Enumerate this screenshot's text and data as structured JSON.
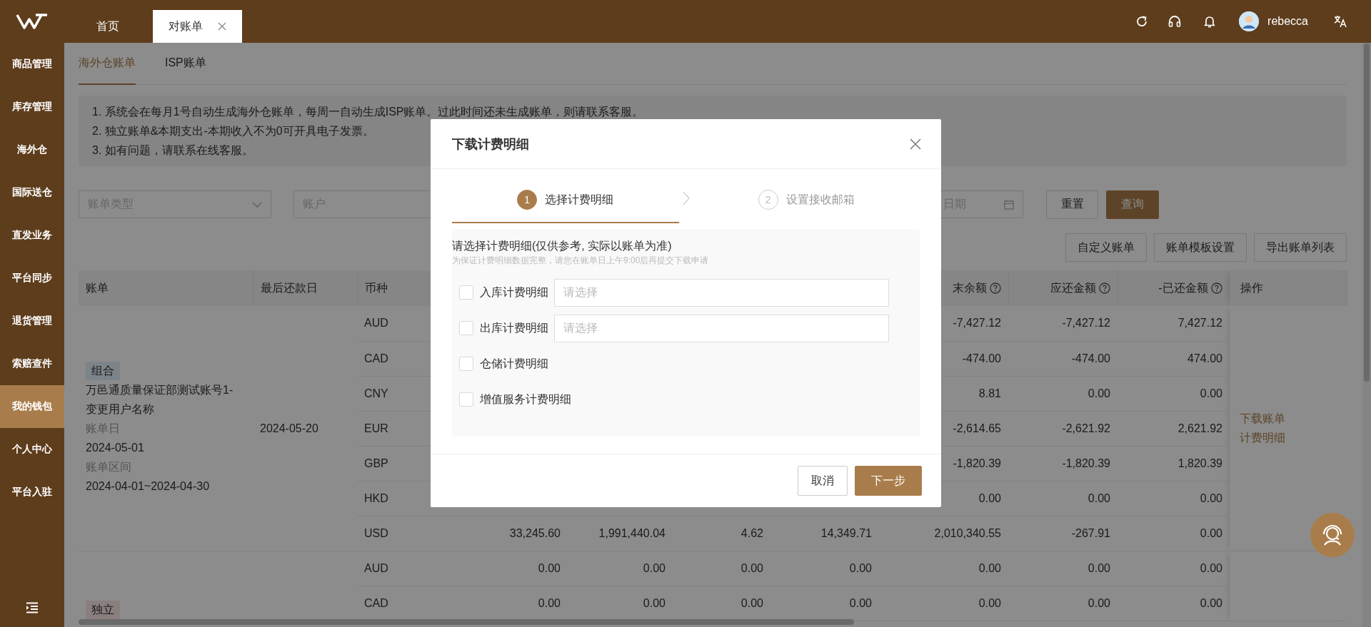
{
  "header": {
    "tabs": [
      {
        "label": "首页",
        "selected": false,
        "closable": false
      },
      {
        "label": "对账单",
        "selected": true,
        "closable": true
      }
    ],
    "user": {
      "name": "rebecca"
    }
  },
  "sidebar": {
    "items": [
      {
        "label": "商品管理",
        "selected": false
      },
      {
        "label": "库存管理",
        "selected": false
      },
      {
        "label": "海外仓",
        "selected": false
      },
      {
        "label": "国际送仓",
        "selected": false
      },
      {
        "label": "直发业务",
        "selected": false
      },
      {
        "label": "平台同步",
        "selected": false
      },
      {
        "label": "退货管理",
        "selected": false
      },
      {
        "label": "索赔查件",
        "selected": false
      },
      {
        "label": "我的钱包",
        "selected": true
      },
      {
        "label": "个人中心",
        "selected": false
      },
      {
        "label": "平台入驻",
        "selected": false
      }
    ]
  },
  "subtabs": [
    {
      "label": "海外仓账单",
      "selected": true
    },
    {
      "label": "ISP账单",
      "selected": false
    }
  ],
  "notice": [
    "1. 系统会在每月1号自动生成海外仓账单，每周一自动生成ISP账单。过此时间还未生成账单，则请联系客服。",
    "2. 独立账单&本期支出-本期收入不为0可开具电子发票。",
    "3. 如有问题，请联系在线客服。"
  ],
  "filters": {
    "bill_type": {
      "placeholder": "账单类型"
    },
    "account": {
      "placeholder": "账户"
    },
    "date": {
      "placeholder": "日期"
    },
    "reset": "重置",
    "search": "查询"
  },
  "actions": [
    "自定义账单",
    "账单模板设置",
    "导出账单列表"
  ],
  "table": {
    "columns": [
      {
        "label": "账单"
      },
      {
        "label": "最后还款日"
      },
      {
        "label": "币种"
      },
      {},
      {},
      {},
      {},
      {
        "label": "末余额",
        "help": true
      },
      {
        "label": "应还金额",
        "help": true
      },
      {
        "label": "-已还金额",
        "help": true
      },
      {
        "label": "操作"
      }
    ],
    "groups": [
      {
        "tag": {
          "text": "组合",
          "kind": "combined"
        },
        "name": "万邑通质量保证部测试账号1-变更用户名称",
        "bill_date_label": "账单日",
        "bill_date": "2024-05-01",
        "period_label": "账单区间",
        "period": "2024-04-01~2024-04-30",
        "due_date": "2024-05-20",
        "actions": [
          "下载账单",
          "计费明细"
        ],
        "lines": [
          {
            "currency": "AUD",
            "column_8": "-7,427.12",
            "payable": "-7,427.12",
            "repaid": "7,427.12"
          },
          {
            "currency": "CAD",
            "column_8": "-474.00",
            "payable": "-474.00",
            "repaid": "474.00"
          },
          {
            "currency": "CNY",
            "column_8": "8.81",
            "payable": "0.00",
            "repaid": "0.00"
          },
          {
            "currency": "EUR",
            "column_8": "-2,614.65",
            "payable": "-2,621.92",
            "repaid": "2,621.92"
          },
          {
            "currency": "GBP",
            "column_8": "-1,820.39",
            "payable": "-1,820.39",
            "repaid": "1,820.39"
          },
          {
            "currency": "HKD",
            "column_8": "0.00",
            "payable": "0.00",
            "repaid": "0.00"
          },
          {
            "currency": "USD",
            "column_4": "33,245.60",
            "column_5": "1,991,440.04",
            "column_6": "4.62",
            "column_7": "14,349.71",
            "column_8": "2,010,340.55",
            "payable": "-267.91",
            "repaid": "0.00"
          }
        ]
      },
      {
        "tag": {
          "text": "独立",
          "kind": "standalone"
        },
        "lines": [
          {
            "currency": "AUD",
            "column_4": "0.00",
            "column_5": "0.00",
            "column_6": "0.00",
            "column_7": "0.00",
            "column_8": "0.00",
            "payable": "0.00",
            "repaid": "0.00"
          },
          {
            "currency": "CAD",
            "column_4": "0.00",
            "column_5": "0.00",
            "column_6": "0.00",
            "column_7": "0.00",
            "column_8": "0.00",
            "payable": "0.00",
            "repaid": "0.00"
          }
        ]
      }
    ]
  },
  "modal": {
    "title": "下载计费明细",
    "steps": [
      {
        "number": "1",
        "label": "选择计费明细",
        "selected": true
      },
      {
        "number": "2",
        "label": "设置接收邮箱",
        "selected": false
      }
    ],
    "heading": "请选择计费明细(仅供参考, 实际以账单为准)",
    "hint": "为保证计费明细数据完整，请您在账单日上午9:00后再提交下载申请",
    "options": [
      {
        "kind": "select",
        "label": "入库计费明细",
        "checked": false,
        "placeholder": "请选择"
      },
      {
        "kind": "select",
        "label": "出库计费明细",
        "checked": false,
        "placeholder": "请选择"
      },
      {
        "kind": "plain",
        "label": "仓储计费明细",
        "checked": false
      },
      {
        "kind": "plain",
        "label": "增值服务计费明细",
        "checked": false
      }
    ],
    "buttons": [
      {
        "kind": "secondary",
        "label": "取消"
      },
      {
        "kind": "primary",
        "label": "下一步"
      }
    ]
  }
}
